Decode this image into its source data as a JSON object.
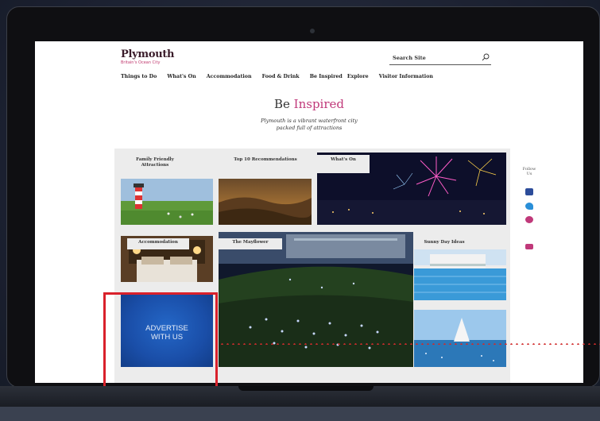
{
  "site": {
    "logo": "Plymouth",
    "logo_sub": "Britain's Ocean City",
    "search_placeholder": "Search Site",
    "nav": [
      "Things to Do",
      "What's On",
      "Accommodation",
      "Food & Drink",
      "Be Inspired",
      "Explore",
      "Visitor Information"
    ]
  },
  "hero": {
    "title_plain": "Be ",
    "title_highlight": "Inspired",
    "subtitle_line1": "Plymouth is a vibrant waterfront city",
    "subtitle_line2": "packed full of attractions"
  },
  "tiles": {
    "family": "Family Friendly Attractions",
    "top10": "Top 10 Recommendations",
    "whatson": "What's On",
    "accommodation": "Accommodation",
    "mayflower": "The Mayflower",
    "sunny": "Sunny Day Ideas"
  },
  "follow": {
    "label": "Follow Us",
    "icons": [
      "facebook-icon",
      "twitter-icon",
      "heart-icon",
      "email-icon"
    ]
  },
  "advert": {
    "line1": "ADVERTISE",
    "line2": "WITH US"
  },
  "colors": {
    "accent_pink": "#c0397a",
    "highlight_red": "#d9212b",
    "advert_blue": "#1a4ea8"
  }
}
